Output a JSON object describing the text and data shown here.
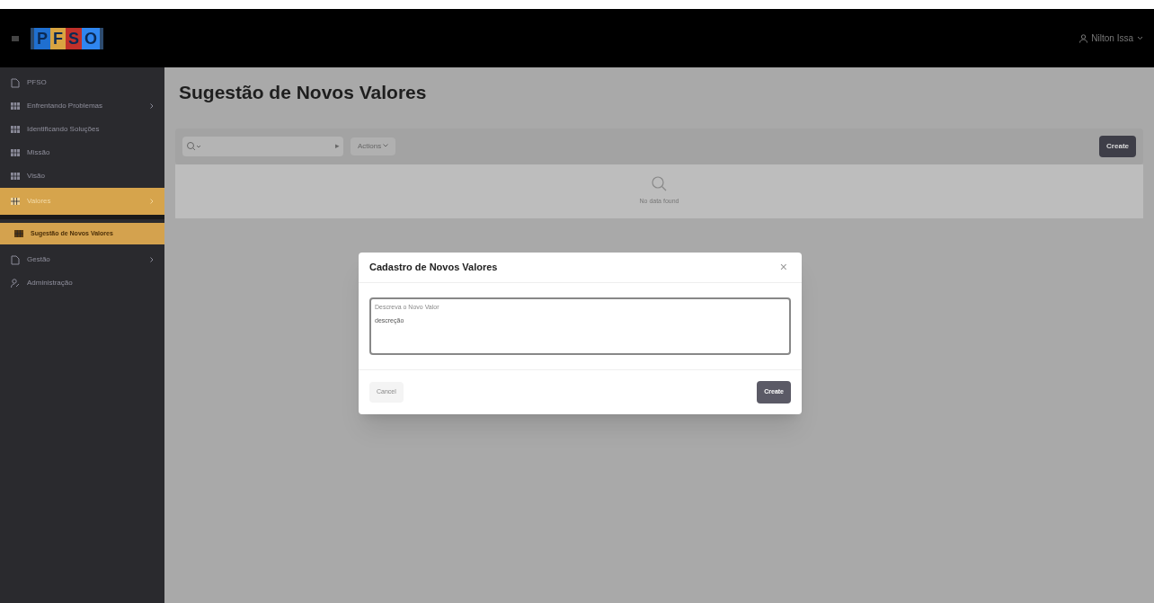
{
  "header": {
    "logo": [
      {
        "letter": "P",
        "color": "#1f6fd0"
      },
      {
        "letter": "F",
        "color": "#d9a441"
      },
      {
        "letter": "S",
        "color": "#c0302a"
      },
      {
        "letter": "O",
        "color": "#2f86f0"
      }
    ],
    "user": "Nilton Issa"
  },
  "sidebar": {
    "items": [
      {
        "label": "PFSO",
        "kind": "page",
        "selected": false,
        "has_children": false
      },
      {
        "label": "Enfrentando Problemas",
        "kind": "grid",
        "selected": false,
        "has_children": true
      },
      {
        "label": "Identificando Soluções",
        "kind": "grid",
        "selected": false,
        "has_children": false
      },
      {
        "label": "Missão",
        "kind": "grid",
        "selected": false,
        "has_children": false
      },
      {
        "label": "Visão",
        "kind": "grid",
        "selected": false,
        "has_children": false
      },
      {
        "label": "Valores",
        "kind": "grid",
        "selected": true,
        "has_children": true,
        "children": [
          {
            "label": "Sugestão de Novos Valores",
            "kind": "grid",
            "selected": true
          }
        ]
      },
      {
        "label": "Gestão",
        "kind": "page",
        "selected": false,
        "has_children": true
      },
      {
        "label": "Administração",
        "kind": "user",
        "selected": false,
        "has_children": false
      }
    ]
  },
  "page": {
    "title": "Sugestão de Novos Valores",
    "toolbar": {
      "go": "▸",
      "actions": "Actions",
      "create": "Create"
    },
    "report": {
      "empty": "No data found"
    }
  },
  "dialog": {
    "title": "Cadastro de Novos Valores",
    "close": "×",
    "field": {
      "label": "Descreva o Novo Valor",
      "value": "descreção"
    },
    "cancel": "Cancel",
    "create": "Create"
  }
}
